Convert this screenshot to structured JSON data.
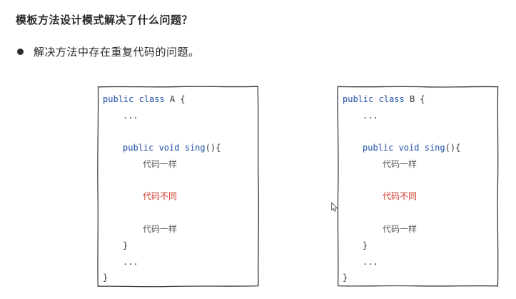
{
  "heading": "模板方法设计模式解决了什么问题？",
  "bullet": "解决方法中存在重复代码的问题。",
  "cards": [
    {
      "kw_class": "public class",
      "class_name": "A",
      "open_brace": "{",
      "ellipsis_top": "...",
      "kw_method": "public void",
      "method_name": "sing",
      "method_tail": "(){",
      "same_code_1": "代码一样",
      "diff_code": "代码不同",
      "same_code_2": "代码一样",
      "method_close": "}",
      "ellipsis_bottom": "...",
      "class_close": "}"
    },
    {
      "kw_class": "public class",
      "class_name": "B",
      "open_brace": "{",
      "ellipsis_top": "...",
      "kw_method": "public void",
      "method_name": "sing",
      "method_tail": "(){",
      "same_code_1": "代码一样",
      "diff_code": "代码不同",
      "same_code_2": "代码一样",
      "method_close": "}",
      "ellipsis_bottom": "...",
      "class_close": "}"
    }
  ],
  "colors": {
    "keyword": "#1f4fa8",
    "different_code": "#d03a2f"
  },
  "icons": {
    "bullet": "filled-circle",
    "cursor": "mouse-pointer-icon"
  }
}
